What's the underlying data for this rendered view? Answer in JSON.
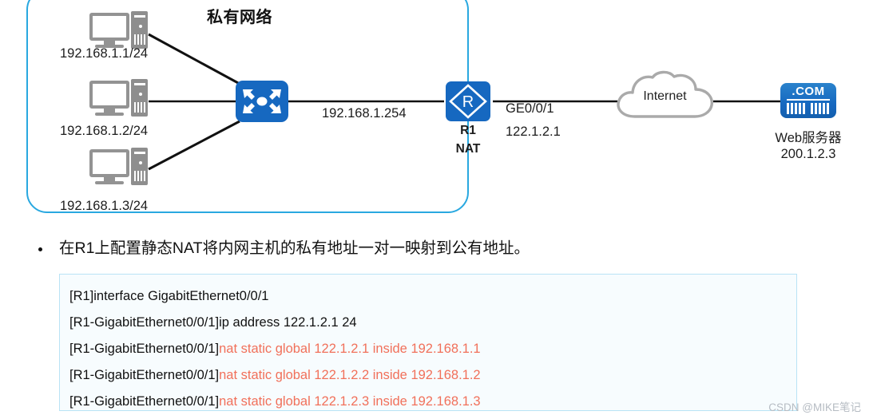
{
  "diagram": {
    "private_network_title": "私有网络",
    "hosts": [
      {
        "id": "pc1",
        "ip_label": "192.168.1.1/24"
      },
      {
        "id": "pc2",
        "ip_label": "192.168.1.2/24"
      },
      {
        "id": "pc3",
        "ip_label": "192.168.1.3/24"
      }
    ],
    "switch": {
      "name": "switch-icon"
    },
    "lan_gateway_label": "192.168.1.254",
    "router": {
      "icon_letter": "R",
      "name_label": "R1",
      "role_label": "NAT",
      "interface_label": "GE0/0/1",
      "interface_ip": "122.1.2.1"
    },
    "cloud": {
      "label": "Internet"
    },
    "web_server": {
      "icon_text": ".COM",
      "name_label": "Web服务器",
      "ip_label": "200.1.2.3"
    },
    "colors": {
      "device_blue": "#1668c0",
      "frame_blue": "#29a8e0",
      "pc_gray": "#939393",
      "cloud_gray": "#aaaaaa",
      "command_red": "#f1705a",
      "code_border": "#b9e3f5",
      "code_bg": "#f7fcfe"
    }
  },
  "bullet": {
    "text": "在R1上配置静态NAT将内网主机的私有地址一对一映射到公有地址。"
  },
  "code_block": {
    "lines": [
      {
        "prompt": "[R1]interface GigabitEthernet0/0/1",
        "command": ""
      },
      {
        "prompt": "[R1-GigabitEthernet0/0/1]ip address 122.1.2.1 24",
        "command": ""
      },
      {
        "prompt": "[R1-GigabitEthernet0/0/1]",
        "command": "nat static global 122.1.2.1 inside 192.168.1.1"
      },
      {
        "prompt": "[R1-GigabitEthernet0/0/1]",
        "command": "nat static global 122.1.2.2 inside 192.168.1.2"
      },
      {
        "prompt": "[R1-GigabitEthernet0/0/1]",
        "command": "nat static global 122.1.2.3 inside 192.168.1.3"
      }
    ]
  },
  "watermark": {
    "text": "CSDN @MIKE笔记"
  }
}
